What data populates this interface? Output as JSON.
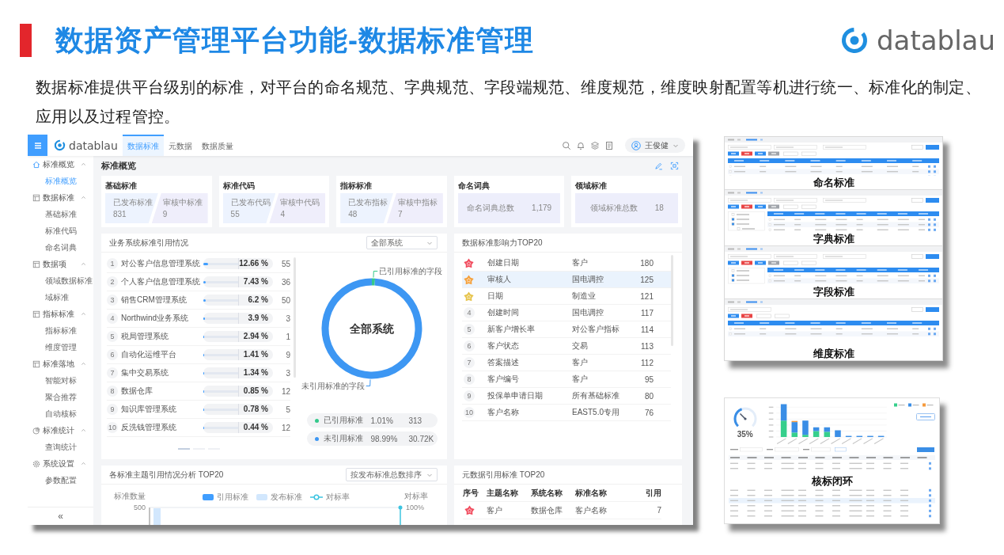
{
  "slide": {
    "title": "数据资产管理平台功能-数据标准管理",
    "logo_text": "datablau",
    "description": "数据标准提供平台级别的标准，对平台的命名规范、字典规范、字段端规范、维度规范，维度映射配置等机进行统一、标准化的制定、应用以及过程管控。"
  },
  "app": {
    "header": {
      "logo_text": "datablau",
      "tabs": [
        {
          "label": "数据标准",
          "selected": true
        },
        {
          "label": "元数据",
          "selected": false
        },
        {
          "label": "数据质量",
          "selected": false
        }
      ],
      "user": {
        "name": "王俊健"
      }
    },
    "sidebar": {
      "groups": [
        {
          "label": "标准概览",
          "expanded": true,
          "items": [
            {
              "label": "标准概览",
              "selected": true
            }
          ]
        },
        {
          "label": "数据标准",
          "expanded": true,
          "items": [
            {
              "label": "基础标准",
              "selected": false
            },
            {
              "label": "标准代码",
              "selected": false
            },
            {
              "label": "命名词典",
              "selected": false
            }
          ]
        },
        {
          "label": "数据项",
          "expanded": true,
          "items": [
            {
              "label": "领域数据标准",
              "selected": false
            },
            {
              "label": "域标准",
              "selected": false
            }
          ]
        },
        {
          "label": "指标标准",
          "expanded": true,
          "items": [
            {
              "label": "指标标准",
              "selected": false
            },
            {
              "label": "维度管理",
              "selected": false
            }
          ]
        },
        {
          "label": "标准落地",
          "expanded": true,
          "items": [
            {
              "label": "智能对标",
              "selected": false
            },
            {
              "label": "聚合推荐",
              "selected": false
            },
            {
              "label": "自动核标",
              "selected": false
            }
          ]
        },
        {
          "label": "标准统计",
          "expanded": true,
          "items": [
            {
              "label": "查询统计",
              "selected": false
            }
          ]
        },
        {
          "label": "系统设置",
          "expanded": true,
          "items": [
            {
              "label": "参数配置",
              "selected": false
            }
          ]
        }
      ],
      "collapse_label": "«"
    },
    "page_title": "标准概览",
    "summary_cards": [
      {
        "title": "基础标准",
        "kind": "split",
        "stats": [
          {
            "label": "已发布标准",
            "value": "831"
          },
          {
            "label": "审核中标准",
            "value": "9"
          }
        ]
      },
      {
        "title": "标准代码",
        "kind": "split",
        "stats": [
          {
            "label": "已发布代码",
            "value": "55"
          },
          {
            "label": "审核中代码",
            "value": "4"
          }
        ]
      },
      {
        "title": "指标标准",
        "kind": "split",
        "stats": [
          {
            "label": "已发布指标",
            "value": "48"
          },
          {
            "label": "审核中指标",
            "value": "7"
          }
        ]
      },
      {
        "title": "命名词典",
        "kind": "total",
        "stats": [
          {
            "label": "命名词典总数",
            "value": "1,179"
          }
        ]
      },
      {
        "title": "领域标准",
        "kind": "total",
        "stats": [
          {
            "label": "领域标准总数",
            "value": "18"
          }
        ]
      }
    ],
    "system_usage": {
      "title": "业务系统标准引用情况",
      "filter": {
        "value": "全部系统"
      },
      "rows": [
        {
          "rank": "1",
          "name": "对公客户信息管理系统",
          "level": 0.1266,
          "percent": "12.66 %",
          "count": "55"
        },
        {
          "rank": "2",
          "name": "个人客户信息管理系统",
          "level": 0.0743,
          "percent": "7.43 %",
          "count": "36"
        },
        {
          "rank": "3",
          "name": "销售CRM管理系统",
          "level": 0.062,
          "percent": "6.2 %",
          "count": "50"
        },
        {
          "rank": "4",
          "name": "Northwind业务系统",
          "level": 0.039,
          "percent": "3.9 %",
          "count": "3"
        },
        {
          "rank": "5",
          "name": "税局管理系统",
          "level": 0.0294,
          "percent": "2.94 %",
          "count": "1"
        },
        {
          "rank": "6",
          "name": "自动化运维平台",
          "level": 0.0141,
          "percent": "1.41 %",
          "count": "9"
        },
        {
          "rank": "7",
          "name": "集中交易系统",
          "level": 0.0134,
          "percent": "1.34 %",
          "count": "3"
        },
        {
          "rank": "8",
          "name": "数据仓库",
          "level": 0.0085,
          "percent": "0.85 %",
          "count": "12"
        },
        {
          "rank": "9",
          "name": "知识库管理系统",
          "level": 0.0078,
          "percent": "0.78 %",
          "count": "5"
        },
        {
          "rank": "10",
          "name": "反洗钱管理系统",
          "level": 0.0044,
          "percent": "0.44 %",
          "count": "12"
        }
      ],
      "pager": [
        {
          "selected": true
        },
        {
          "selected": false
        },
        {
          "selected": false
        }
      ],
      "chart_data": {
        "type": "donut",
        "title": "全部系统",
        "categories": [
          "已引用标准的字段",
          "未引用标准的字段"
        ],
        "values": [
          1.01,
          98.99
        ]
      },
      "legend": [
        {
          "label": "已引用标准",
          "color": "#34c98b",
          "percent": "1.01%",
          "count": "313"
        },
        {
          "label": "未引用标准",
          "color": "#3d97f3",
          "percent": "98.99%",
          "count": "30.72K"
        }
      ]
    },
    "influence_top20": {
      "title": "数据标准影响力TOP20",
      "rows": [
        {
          "kind": "medal",
          "color": "#f14b5d",
          "name": "创建日期",
          "category": "客户",
          "count": "180",
          "selected": false
        },
        {
          "kind": "medal",
          "color": "#f5a03a",
          "name": "审核人",
          "category": "国电调控",
          "count": "125",
          "selected": true
        },
        {
          "kind": "medal",
          "color": "#e6c34a",
          "name": "日期",
          "category": "制造业",
          "count": "121",
          "selected": false
        },
        {
          "kind": "number",
          "rank": "4",
          "name": "创建时间",
          "category": "国电调控",
          "count": "117",
          "selected": false
        },
        {
          "kind": "number",
          "rank": "5",
          "name": "新客户增长率",
          "category": "对公客户指标",
          "count": "114",
          "selected": false
        },
        {
          "kind": "number",
          "rank": "6",
          "name": "客户状态",
          "category": "交易",
          "count": "113",
          "selected": false
        },
        {
          "kind": "number",
          "rank": "7",
          "name": "答案描述",
          "category": "客户",
          "count": "112",
          "selected": false
        },
        {
          "kind": "number",
          "rank": "8",
          "name": "客户编号",
          "category": "客户",
          "count": "95",
          "selected": false
        },
        {
          "kind": "number",
          "rank": "9",
          "name": "投保单申请日期",
          "category": "所有基础标准",
          "count": "80",
          "selected": false
        },
        {
          "kind": "number",
          "rank": "10",
          "name": "客户名称",
          "category": "EAST5.0专用",
          "count": "76",
          "selected": false
        }
      ]
    },
    "subject_analysis": {
      "title": "各标准主题引用情况分析 TOP20",
      "sort": {
        "value": "按发布标准总数排序"
      },
      "legend": [
        {
          "label": "引用标准",
          "kind": "bar",
          "color": "#409eff"
        },
        {
          "label": "发布标准",
          "kind": "bar",
          "color": "#d2e7fd"
        },
        {
          "label": "对标率",
          "kind": "line",
          "color": "#3cc4e0"
        }
      ],
      "y_left": {
        "label": "标准数量",
        "tick": "500"
      },
      "y_right": {
        "label": "对标率",
        "tick": "100%"
      }
    },
    "metadata_top20": {
      "title": "元数据引用标准 TOP20",
      "columns": [
        "序号",
        "主题名称",
        "系统名称",
        "标准名称",
        "引用"
      ],
      "rows": [
        {
          "kind": "medal",
          "color": "#f14b5d",
          "topic": "客户",
          "system": "数据仓库",
          "standard": "客户名称",
          "references": "7"
        }
      ]
    }
  },
  "thumbnails": [
    {
      "caption": "命名标准",
      "kind": "table"
    },
    {
      "caption": "字典标准",
      "kind": "tree"
    },
    {
      "caption": "字段标准",
      "kind": "tree"
    },
    {
      "caption": "维度标准",
      "kind": "table"
    }
  ],
  "dashboard_thumbnail": {
    "caption": "核标闭环",
    "gauge_reading": "35%"
  }
}
